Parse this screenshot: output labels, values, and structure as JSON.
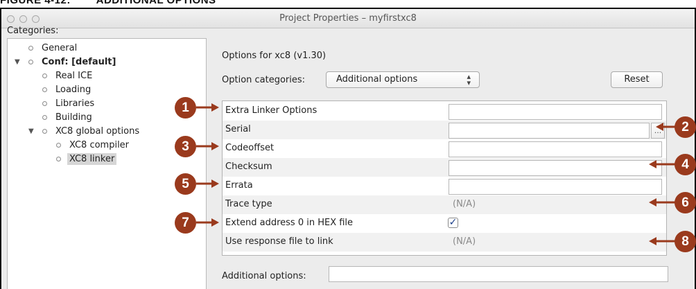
{
  "figure_caption": "FIGURE 4-12:        ADDITIONAL OPTIONS",
  "window": {
    "title": "Project Properties – myfirstxc8"
  },
  "sidebar": {
    "label": "Categories:",
    "items": [
      {
        "label": "General",
        "expanded": null,
        "bold": false,
        "selected": false
      },
      {
        "label": "Conf: [default]",
        "expanded": true,
        "bold": true,
        "selected": false
      },
      {
        "label": "Real ICE",
        "expanded": null,
        "bold": false,
        "selected": false
      },
      {
        "label": "Loading",
        "expanded": null,
        "bold": false,
        "selected": false
      },
      {
        "label": "Libraries",
        "expanded": null,
        "bold": false,
        "selected": false
      },
      {
        "label": "Building",
        "expanded": null,
        "bold": false,
        "selected": false
      },
      {
        "label": "XC8 global options",
        "expanded": true,
        "bold": false,
        "selected": false
      },
      {
        "label": "XC8 compiler",
        "expanded": null,
        "bold": false,
        "selected": false
      },
      {
        "label": "XC8 linker",
        "expanded": null,
        "bold": false,
        "selected": true
      }
    ]
  },
  "main": {
    "options_for": "Options for xc8 (v1.30)",
    "option_categories_label": "Option categories:",
    "option_categories_value": "Additional options",
    "reset_label": "Reset",
    "options": [
      {
        "name": "Extra Linker Options",
        "control": "text",
        "value": ""
      },
      {
        "name": "Serial",
        "control": "text-browse",
        "value": "",
        "browse_label": "..."
      },
      {
        "name": "Codeoffset",
        "control": "text",
        "value": ""
      },
      {
        "name": "Checksum",
        "control": "text",
        "value": ""
      },
      {
        "name": "Errata",
        "control": "text",
        "value": ""
      },
      {
        "name": "Trace type",
        "control": "na",
        "value": "(N/A)"
      },
      {
        "name": "Extend address 0 in HEX file",
        "control": "checkbox",
        "checked": true
      },
      {
        "name": "Use response file to link",
        "control": "na",
        "value": "(N/A)"
      }
    ],
    "additional_options_label": "Additional options:",
    "additional_options_value": ""
  },
  "callouts": [
    "1",
    "2",
    "3",
    "4",
    "5",
    "6",
    "7",
    "8"
  ],
  "colors": {
    "callout": "#9a3a1d",
    "checkmark": "#1a3e8a",
    "selected_row": "#d6d6d6"
  }
}
